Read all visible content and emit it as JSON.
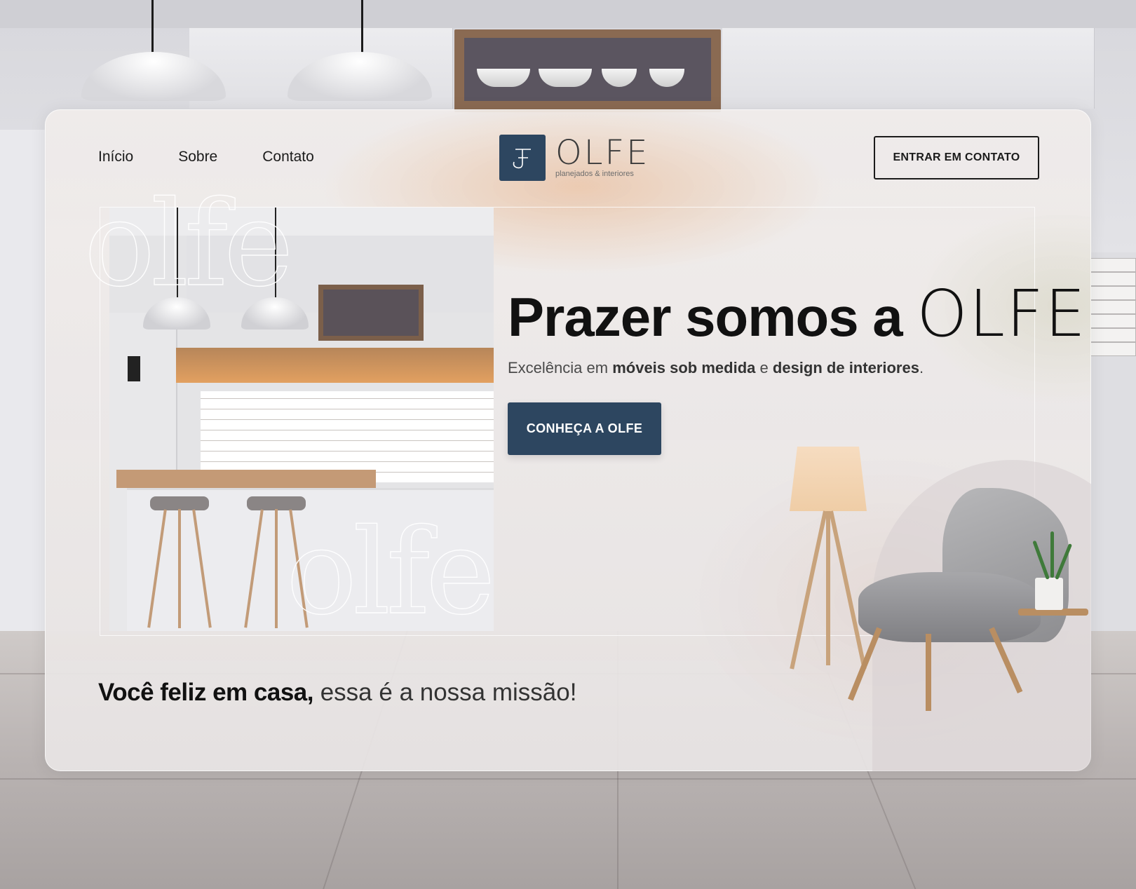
{
  "nav": {
    "items": [
      {
        "label": "Início"
      },
      {
        "label": "Sobre"
      },
      {
        "label": "Contato"
      }
    ]
  },
  "brand": {
    "name": "OLFE",
    "tagline": "planejados & interiores",
    "monogram": "F",
    "color": "#2d4660"
  },
  "header": {
    "cta_label": "ENTRAR EM CONTATO"
  },
  "hero": {
    "headline_bold": "Prazer somos a",
    "headline_thin": "OLFE",
    "subtitle": {
      "part1": "Excelência em",
      "bold1": "móveis sob medida",
      "part2": "e",
      "bold2": "design de interiores",
      "part3": "."
    },
    "cta_label": "CONHEÇA A OLFE",
    "watermark_text": "olfe"
  },
  "mission": {
    "bold": "Você feliz em casa,",
    "rest": "essa é a nossa missão!"
  },
  "colors": {
    "primary": "#2d4660",
    "text": "#111111",
    "accent_glow": "#e8b084"
  }
}
